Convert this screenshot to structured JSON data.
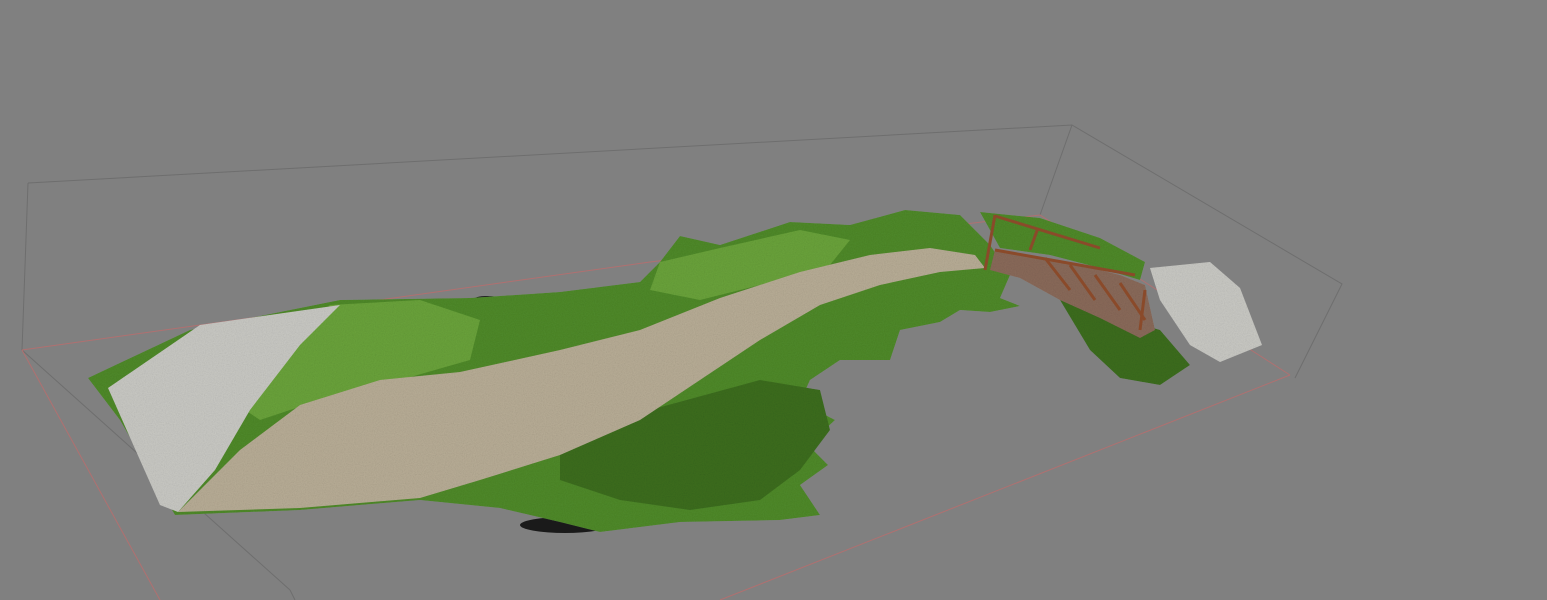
{
  "viewport": {
    "background_color": "#808080",
    "bounding_box_color": "#6e6e6e",
    "ground_plane_color": "#b07070"
  },
  "model": {
    "grass_color": "#4f8a2a",
    "grass_dark_color": "#3c6d1f",
    "grass_light_color": "#6aa33b",
    "path_color": "#b8ad96",
    "sidewalk_color": "#c9c9c4",
    "bridge_color": "#8a6a5a",
    "railing_color": "#8a4a2a",
    "shadow_color": "#1a1a1a"
  }
}
